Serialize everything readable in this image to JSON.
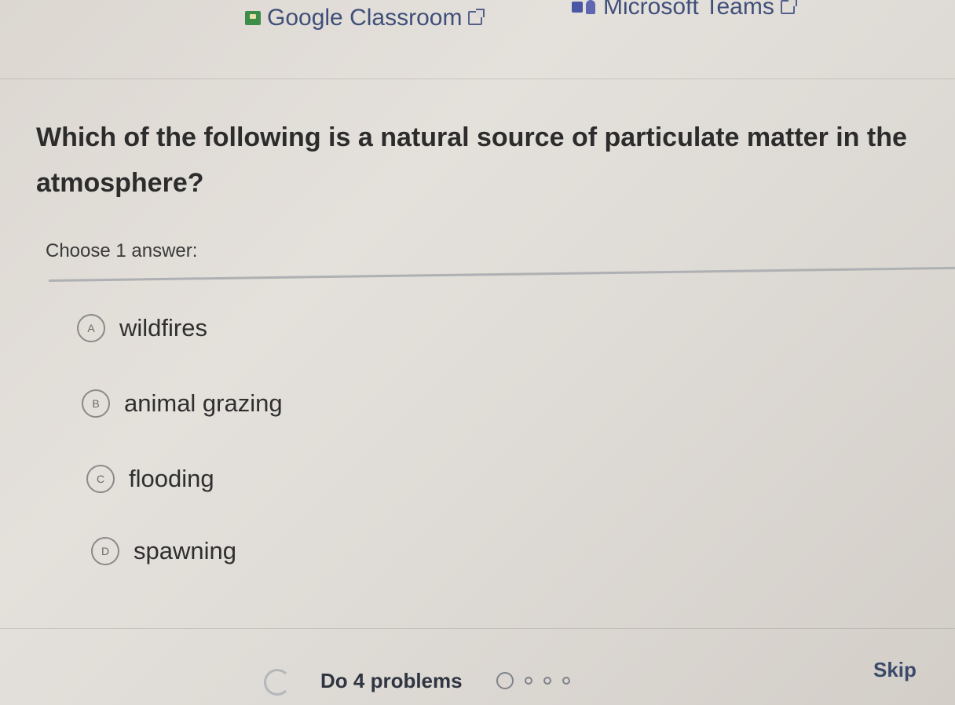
{
  "top_links": {
    "classroom_label": "Google Classroom",
    "teams_label": "Microsoft Teams"
  },
  "question": {
    "text": "Which of the following is a natural source of particulate matter in the atmosphere?",
    "instruction": "Choose 1 answer:"
  },
  "options": [
    {
      "letter": "A",
      "text": "wildfires"
    },
    {
      "letter": "B",
      "text": "animal grazing"
    },
    {
      "letter": "C",
      "text": "flooding"
    },
    {
      "letter": "D",
      "text": "spawning"
    }
  ],
  "footer": {
    "progress_label": "Do 4 problems",
    "progress_total": 4,
    "progress_current": 1,
    "skip_label": "Skip"
  },
  "icons": {
    "classroom": "google-classroom-icon",
    "teams": "microsoft-teams-icon",
    "external": "external-link-icon",
    "reload": "reload-icon"
  }
}
